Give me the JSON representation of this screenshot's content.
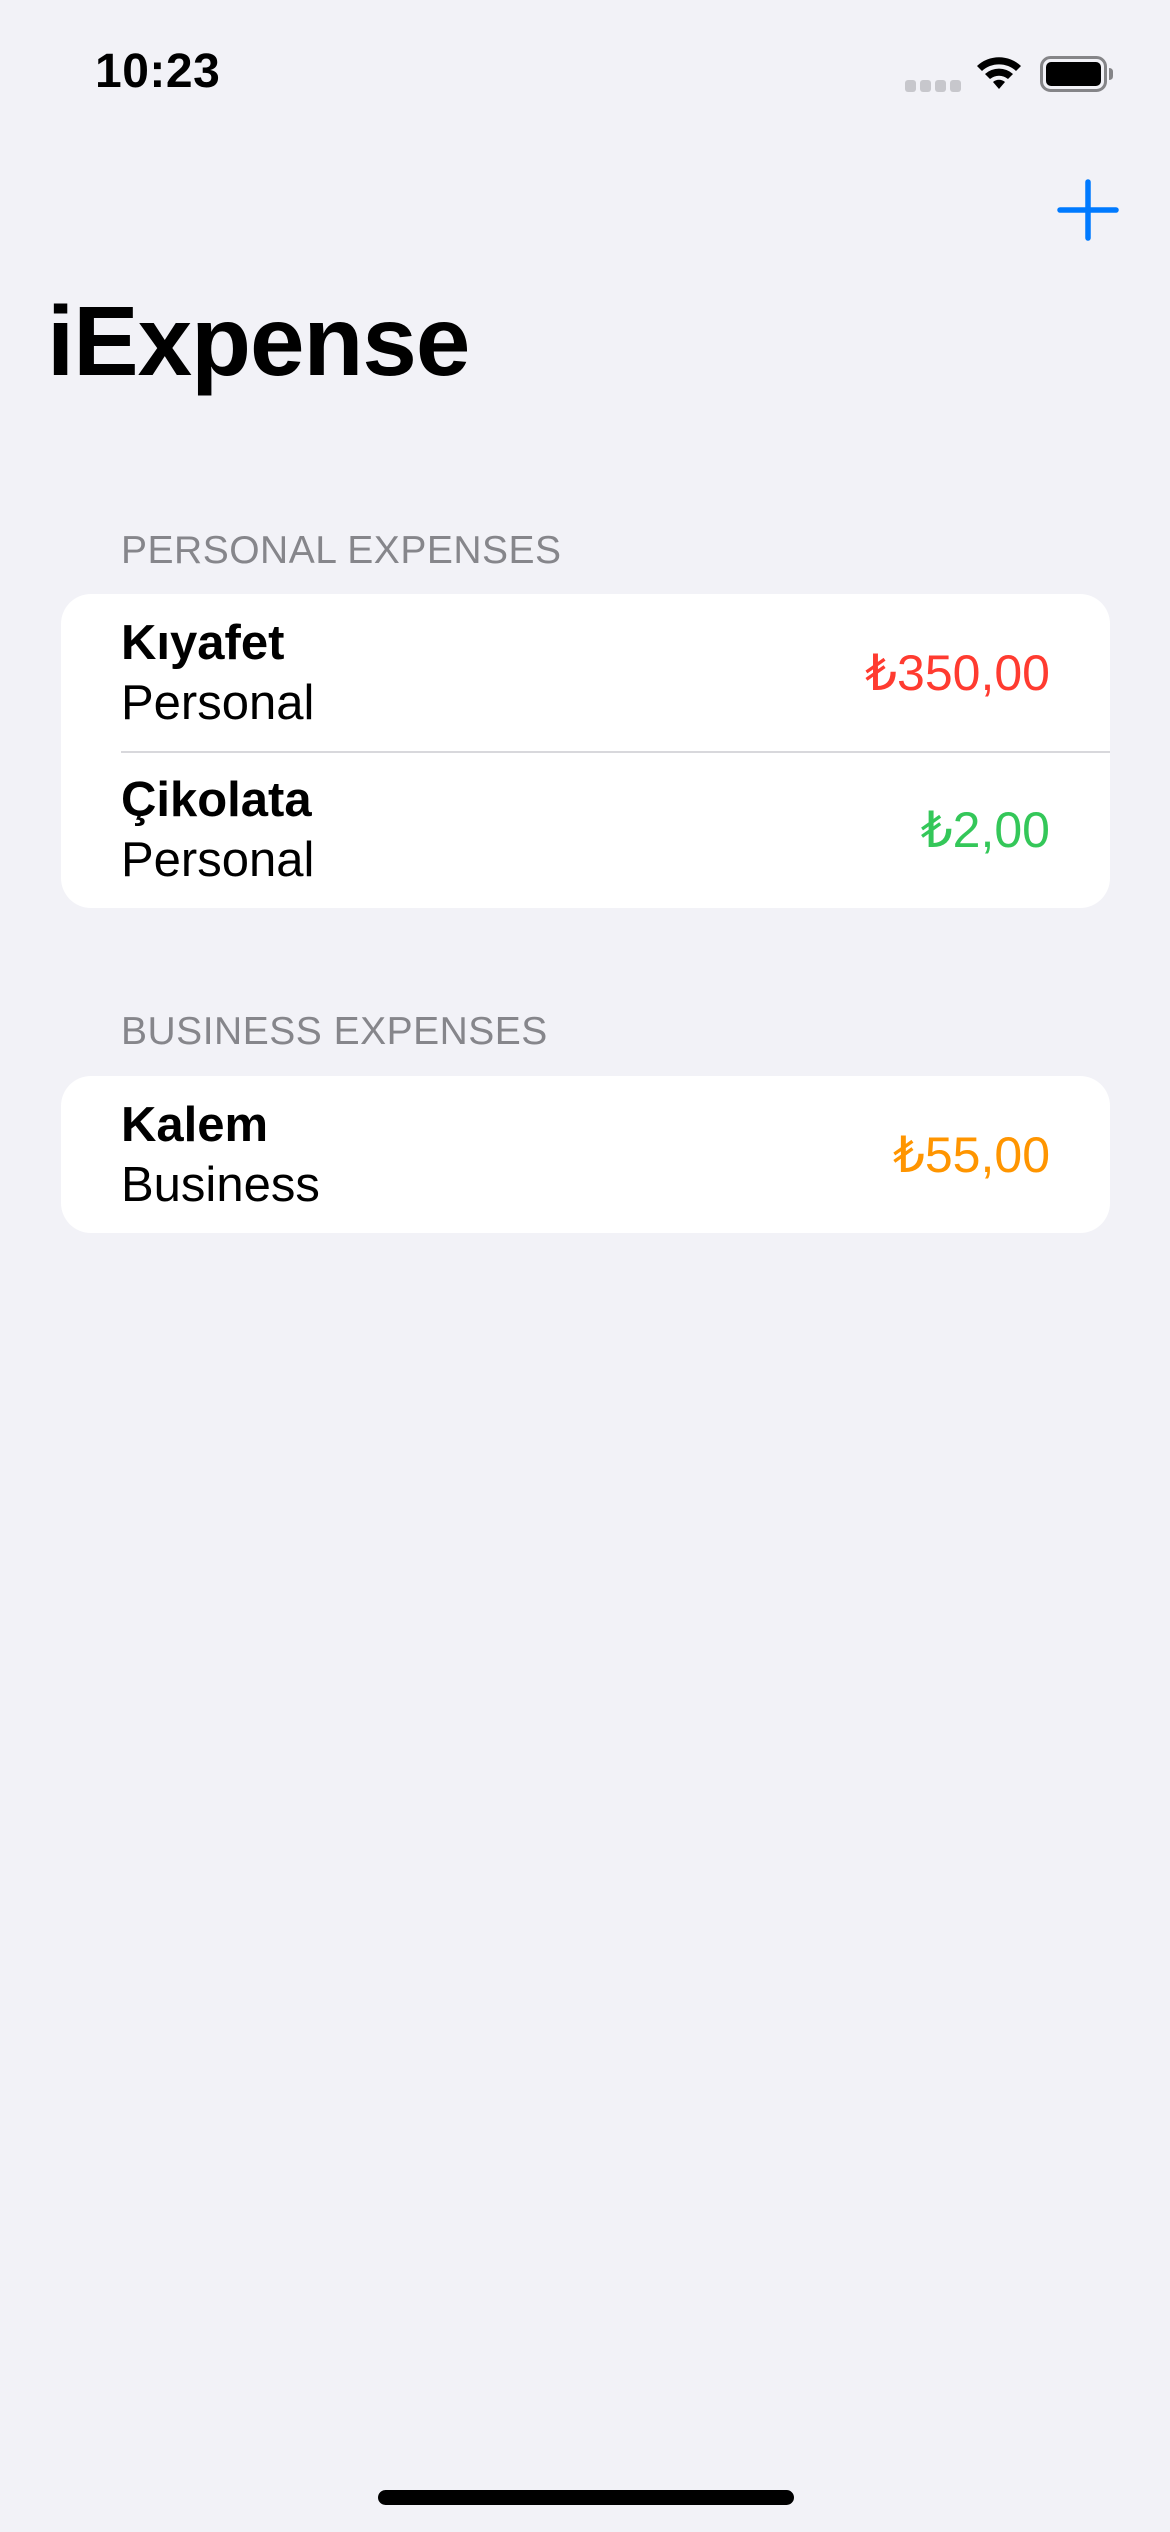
{
  "status_bar": {
    "time": "10:23",
    "icons": [
      "cellular-signal-icon",
      "wifi-icon",
      "battery-icon"
    ]
  },
  "nav": {
    "title": "iExpense",
    "add_icon": "plus-icon"
  },
  "colors": {
    "accent": "#007aff",
    "background": "#f2f2f7",
    "amount_high": "#ff3b30",
    "amount_low": "#34c759",
    "amount_medium": "#ff9500"
  },
  "sections": [
    {
      "header": "PERSONAL EXPENSES",
      "items": [
        {
          "name": "Kıyafet",
          "type": "Personal",
          "amount": "₺350,00",
          "color": "#ff3b30"
        },
        {
          "name": "Çikolata",
          "type": "Personal",
          "amount": "₺2,00",
          "color": "#34c759"
        }
      ]
    },
    {
      "header": "BUSINESS EXPENSES",
      "items": [
        {
          "name": "Kalem",
          "type": "Business",
          "amount": "₺55,00",
          "color": "#ff9500"
        }
      ]
    }
  ]
}
